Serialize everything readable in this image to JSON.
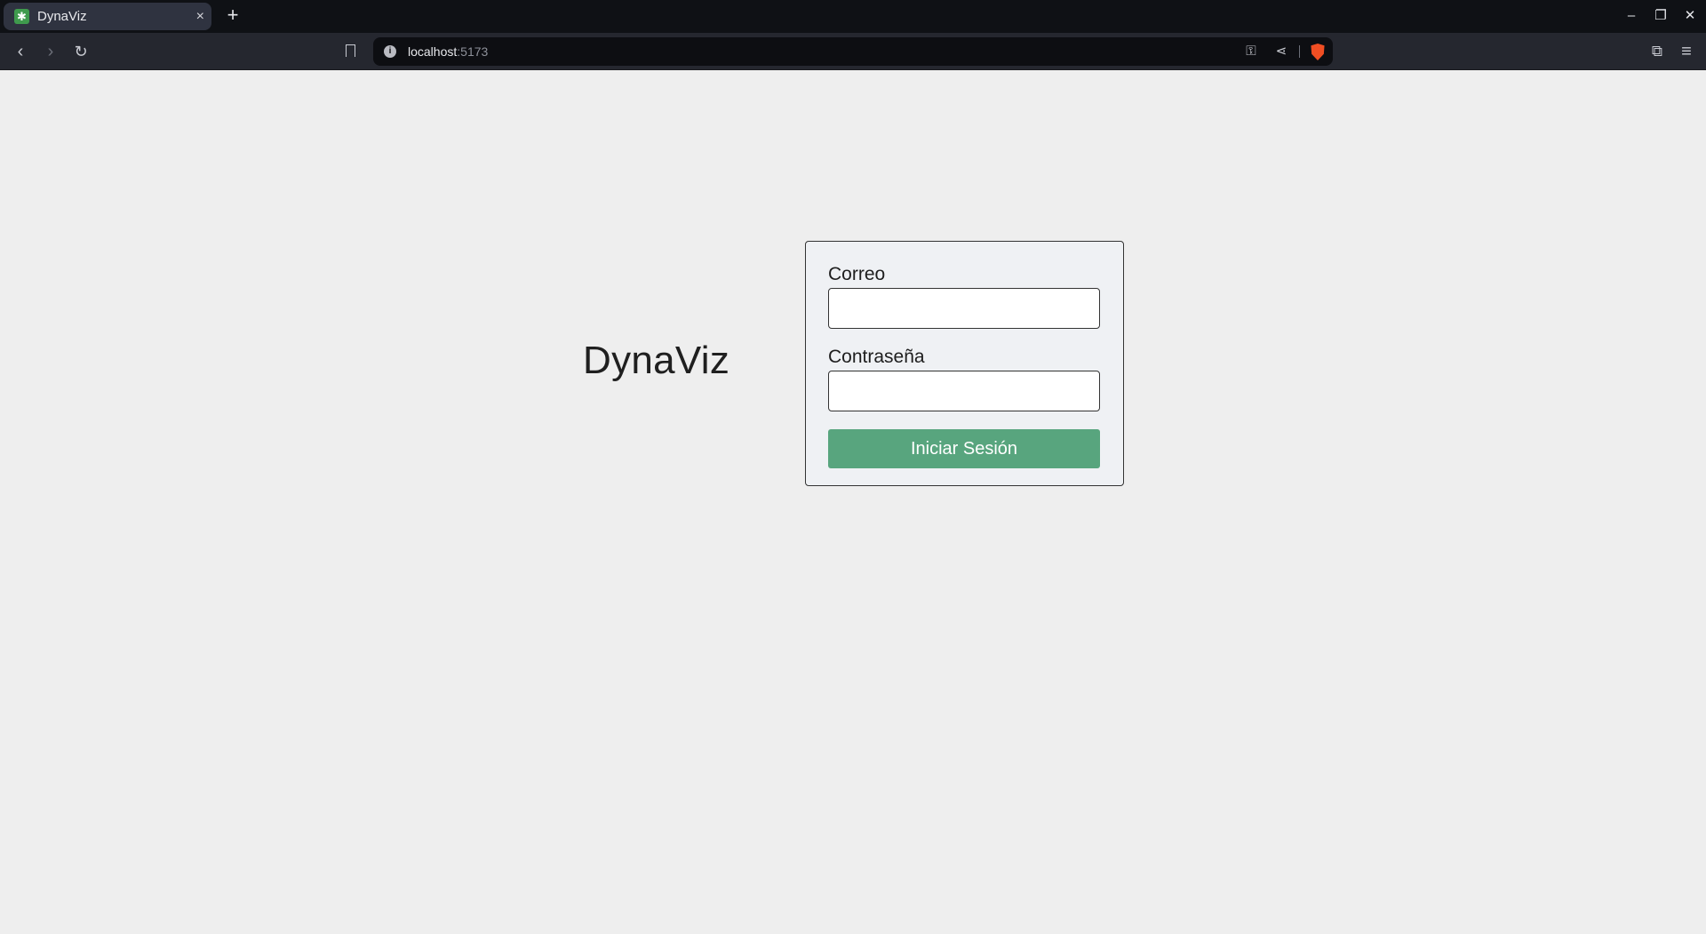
{
  "browser": {
    "tab_title": "DynaViz",
    "tab_close": "×",
    "new_tab": "+",
    "url_host": "localhost",
    "url_port": ":5173",
    "icons": {
      "favicon": "✱",
      "back": "‹",
      "forward": "›",
      "reload": "↻",
      "info": "i",
      "key": "⚿",
      "share": "⋖",
      "extensions": "⧉",
      "menu": "≡",
      "minimize": "–",
      "restore": "❐",
      "close": "✕"
    },
    "accent": "#f04e23"
  },
  "page": {
    "brand_title": "DynaViz",
    "login": {
      "email_label": "Correo",
      "email_value": "",
      "password_label": "Contraseña",
      "password_value": "",
      "submit_label": "Iniciar Sesión"
    },
    "colors": {
      "background": "#eeeeee",
      "card": "#eff1f4",
      "button": "#58a57e"
    }
  }
}
